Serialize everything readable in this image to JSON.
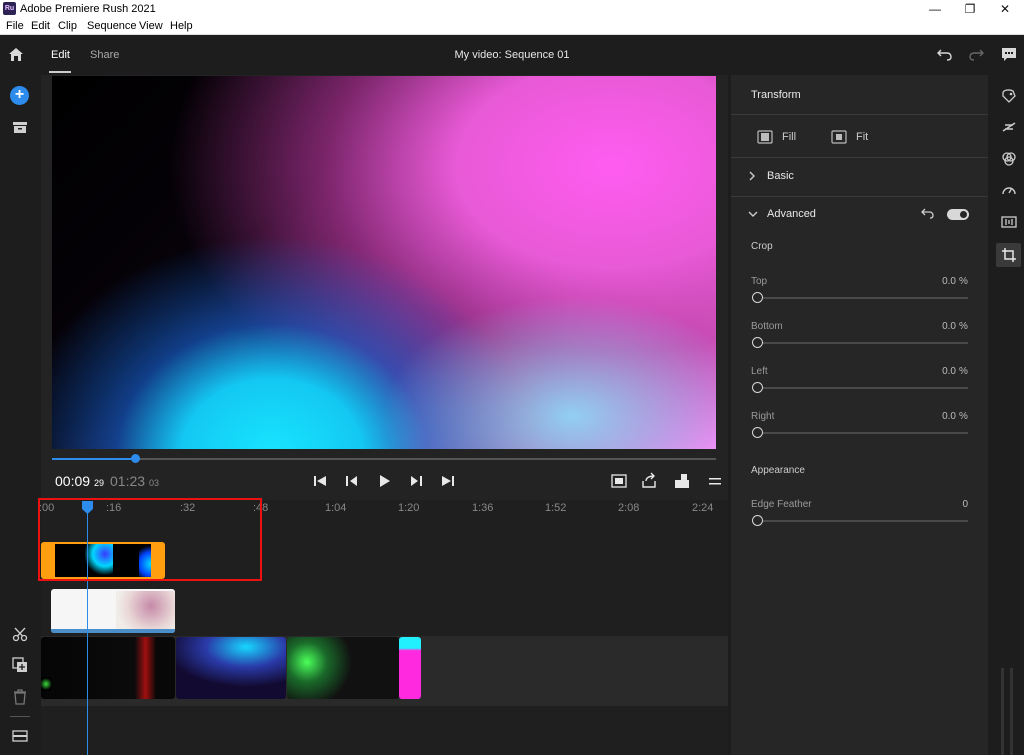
{
  "window": {
    "app_icon_text": "Ru",
    "title": "Adobe Premiere Rush 2021",
    "minimize": "—",
    "restore": "❐",
    "close": "✕"
  },
  "menu": [
    "File",
    "Edit",
    "Clip",
    "Sequence",
    "View",
    "Help"
  ],
  "header": {
    "tabs": [
      "Edit",
      "Share"
    ],
    "active_tab": "Edit",
    "sequence_title": "My video: Sequence 01"
  },
  "playback": {
    "current_time": "00:09",
    "current_frames": "29",
    "duration": "01:23",
    "duration_frames": "03",
    "progress_fraction": 0.125
  },
  "ruler": {
    "ticks": [
      ":00",
      ":16",
      ":32",
      ":48",
      "1:04",
      "1:20",
      "1:36",
      "1:52",
      "2:08",
      "2:24"
    ]
  },
  "inspector": {
    "section_title": "Transform",
    "fill_label": "Fill",
    "fit_label": "Fit",
    "basic_label": "Basic",
    "advanced_label": "Advanced",
    "advanced_enabled": true,
    "crop_label": "Crop",
    "crop": [
      {
        "label": "Top",
        "value": "0.0",
        "unit": "%"
      },
      {
        "label": "Bottom",
        "value": "0.0",
        "unit": "%"
      },
      {
        "label": "Left",
        "value": "0.0",
        "unit": "%"
      },
      {
        "label": "Right",
        "value": "0.0",
        "unit": "%"
      }
    ],
    "appearance_label": "Appearance",
    "edge_feather_label": "Edge Feather",
    "edge_feather_value": "0"
  },
  "colors": {
    "accent": "#2d8ceb",
    "title_clip": "#ff9f0f",
    "highlight_box": "#ee1111"
  },
  "icons": {
    "home": "home-icon",
    "add": "add-media-icon",
    "projects": "projects-icon",
    "split": "scissors-icon",
    "duplicate": "duplicate-icon",
    "delete": "trash-icon",
    "track_options": "track-options-icon",
    "undo": "undo-icon",
    "redo": "redo-icon",
    "comment": "comment-icon"
  }
}
